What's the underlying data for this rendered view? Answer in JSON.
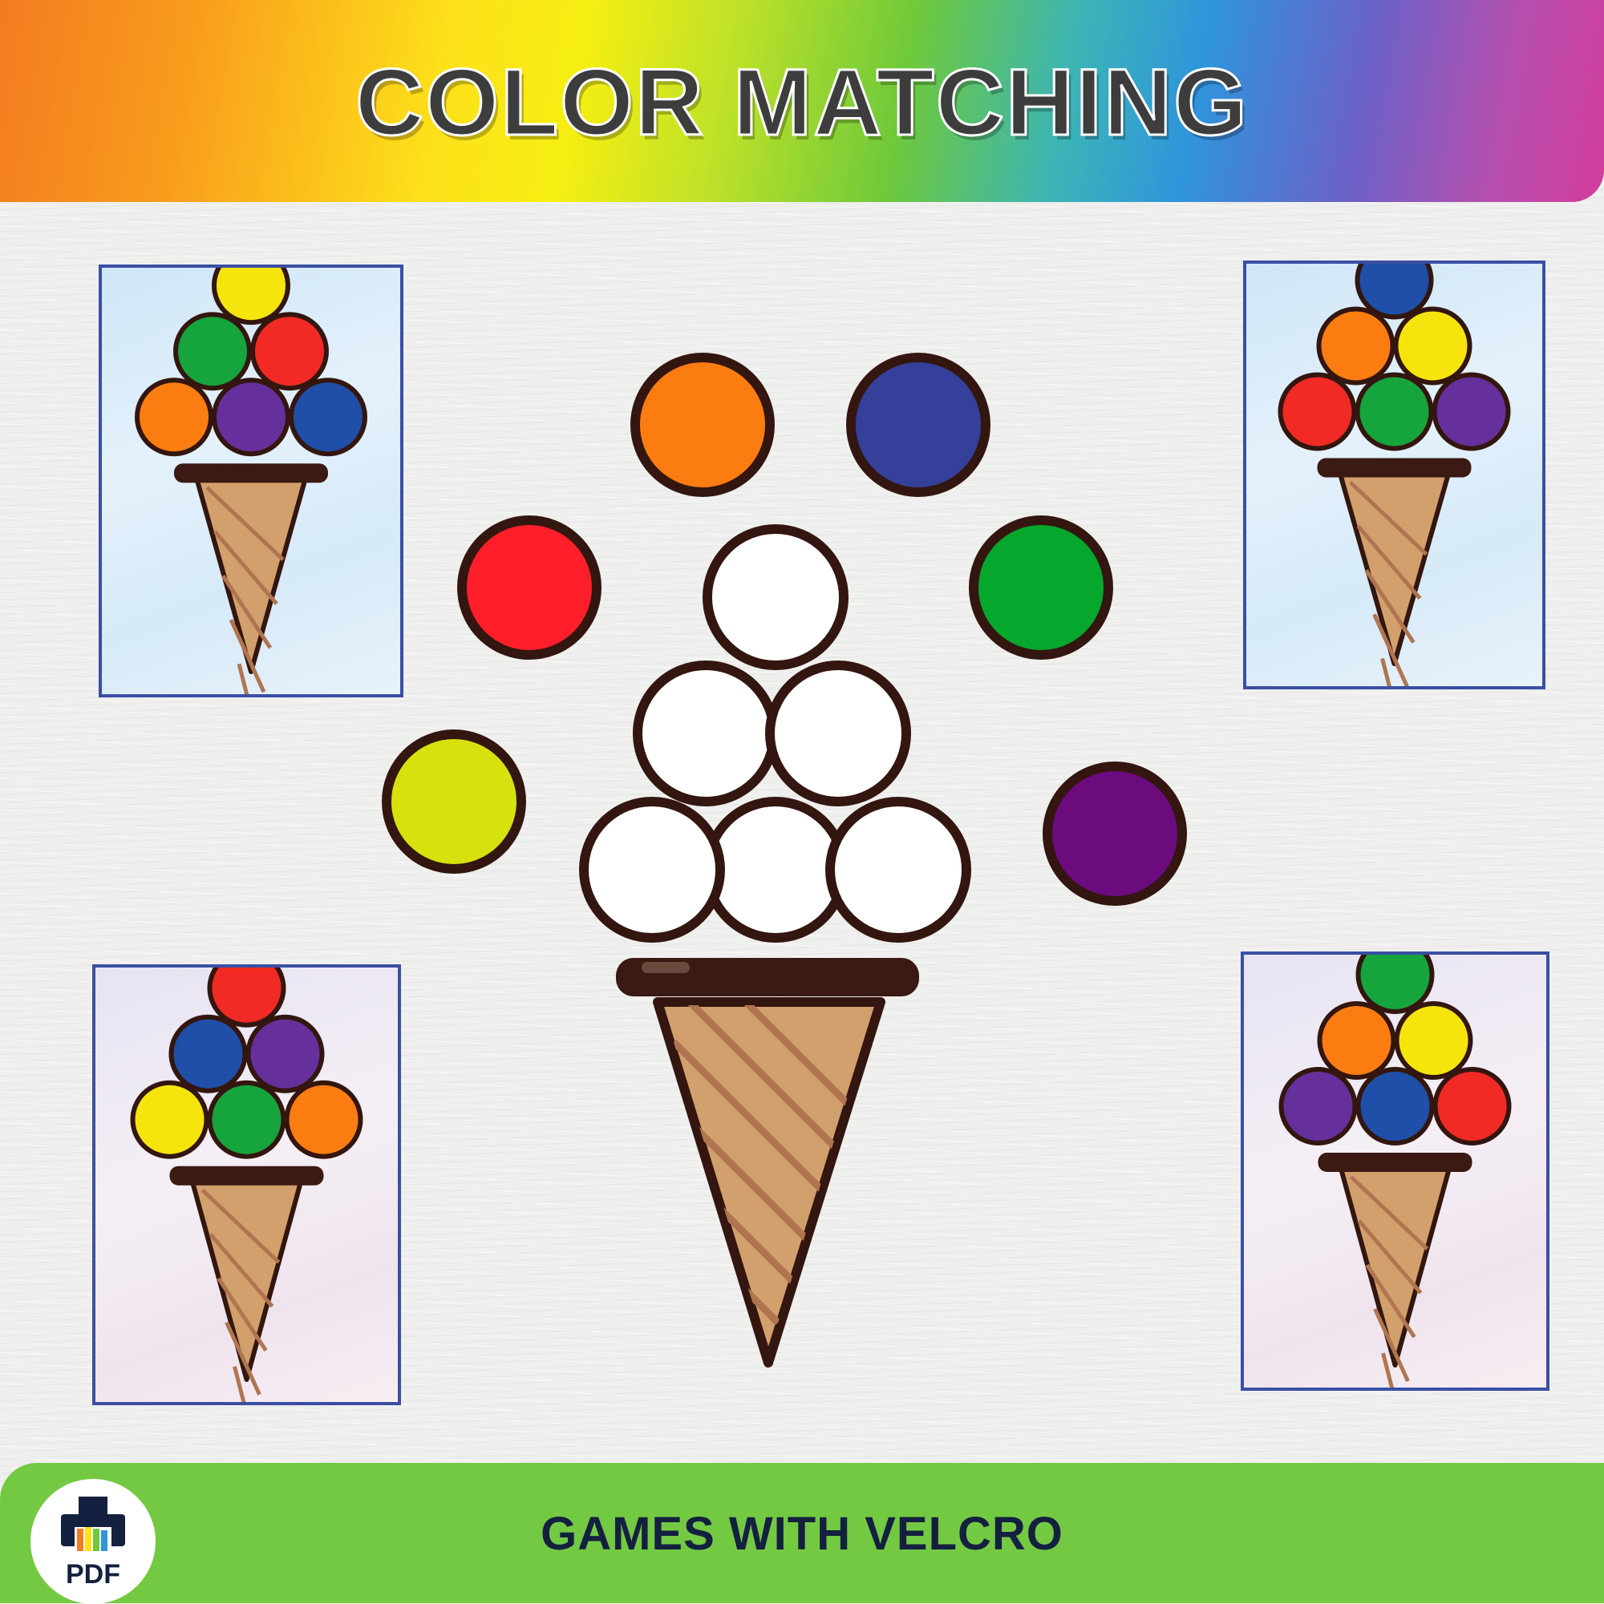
{
  "header": {
    "title": "COLOR MATCHING"
  },
  "footer": {
    "label": "GAMES WITH VELCRO",
    "badge_label": "PDF",
    "badge_icon": "printer-icon"
  },
  "colors": {
    "yellow": "#f5e50d",
    "green": "#16a43c",
    "red": "#f12a25",
    "orange": "#fb7d12",
    "purple": "#65309b",
    "blue": "#1f4fa8",
    "outline": "#33160f",
    "cone": "#d2a06c",
    "cone_stripe": "#b07550"
  },
  "loose_balls": [
    {
      "color": "#fb7d12"
    },
    {
      "color": "#34409a"
    },
    {
      "color": "#fe1f2a"
    },
    {
      "color": "#05a82d"
    },
    {
      "color": "#d6e10e"
    },
    {
      "color": "#6b0b7e"
    }
  ],
  "cards": [
    {
      "theme": "blue",
      "scoops": [
        "yellow",
        "green",
        "red",
        "orange",
        "purple",
        "blue"
      ]
    },
    {
      "theme": "blue",
      "scoops": [
        "blue",
        "orange",
        "yellow",
        "red",
        "green",
        "purple"
      ]
    },
    {
      "theme": "pink",
      "scoops": [
        "red",
        "blue",
        "purple",
        "yellow",
        "green",
        "orange"
      ]
    },
    {
      "theme": "pink",
      "scoops": [
        "green",
        "orange",
        "yellow",
        "purple",
        "blue",
        "red"
      ]
    }
  ]
}
